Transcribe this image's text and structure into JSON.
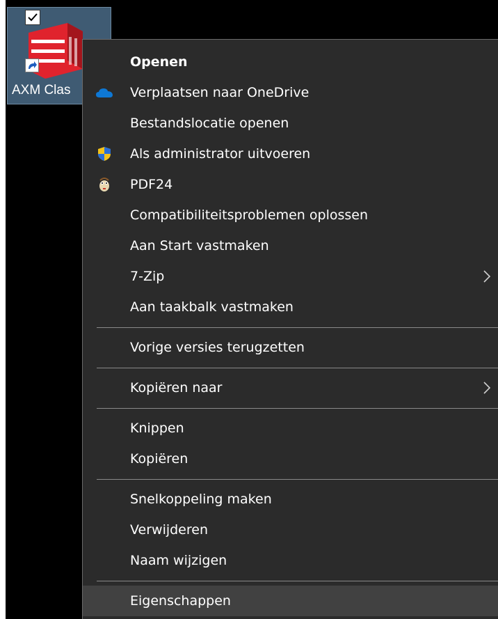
{
  "desktop_icon": {
    "label": "AXM Clas",
    "checked": true,
    "colors": {
      "logo": "#e0232d",
      "selection": "#3f5b73"
    }
  },
  "context_menu": {
    "items": [
      {
        "label": "Openen",
        "bold": true,
        "icon": ""
      },
      {
        "label": "Verplaatsen naar OneDrive",
        "icon": "onedrive-cloud-icon"
      },
      {
        "label": "Bestandslocatie openen",
        "icon": ""
      },
      {
        "label": "Als administrator uitvoeren",
        "icon": "uac-shield-icon"
      },
      {
        "label": "PDF24",
        "icon": "pdf24-icon"
      },
      {
        "label": "Compatibiliteitsproblemen oplossen",
        "icon": ""
      },
      {
        "label": "Aan Start vastmaken",
        "icon": ""
      },
      {
        "label": "7-Zip",
        "icon": "",
        "submenu": true
      },
      {
        "label": "Aan taakbalk vastmaken",
        "icon": ""
      },
      {
        "label": "Vorige versies terugzetten",
        "icon": ""
      },
      {
        "label": "Kopiëren naar",
        "icon": "",
        "submenu": true
      },
      {
        "label": "Knippen",
        "icon": ""
      },
      {
        "label": "Kopiëren",
        "icon": ""
      },
      {
        "label": "Snelkoppeling maken",
        "icon": ""
      },
      {
        "label": "Verwijderen",
        "icon": ""
      },
      {
        "label": "Naam wijzigen",
        "icon": ""
      },
      {
        "label": "Eigenschappen",
        "icon": "",
        "hovered": true
      }
    ],
    "colors": {
      "background": "#2b2b2b",
      "text": "#ffffff",
      "hover": "#414141",
      "separator": "#8a8a8a"
    }
  }
}
